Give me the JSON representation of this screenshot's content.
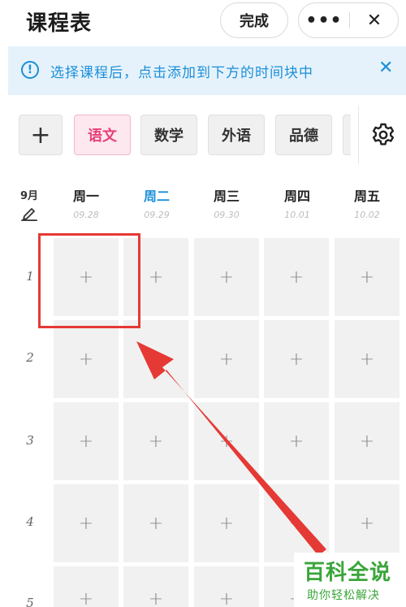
{
  "header": {
    "title": "课程表",
    "done_label": "完成",
    "more_label": "•••",
    "close_label": "✕"
  },
  "banner": {
    "info_label": "!",
    "text": "选择课程后，点击添加到下方的时间块中",
    "close_label": "✕"
  },
  "courses": {
    "add_label": "+",
    "items": [
      "语文",
      "数学",
      "外语",
      "品德"
    ],
    "selected": "语文",
    "settings_icon": "gear-icon"
  },
  "schedule": {
    "month": "9月",
    "days": [
      {
        "name": "周一",
        "date": "09.28"
      },
      {
        "name": "周二",
        "date": "09.29",
        "today": true
      },
      {
        "name": "周三",
        "date": "09.30"
      },
      {
        "name": "周四",
        "date": "10.01"
      },
      {
        "name": "周五",
        "date": "10.02"
      }
    ],
    "periods": [
      "1",
      "2",
      "3",
      "4",
      "5"
    ],
    "cell_label": "+"
  },
  "colors": {
    "accent_blue": "#1a8fd9",
    "selected_pink": "#e8407a",
    "annotation_red": "#e53935",
    "watermark_green": "#3aa53a"
  },
  "watermark": {
    "top": "百科全说",
    "bottom": "助你轻松解决"
  }
}
